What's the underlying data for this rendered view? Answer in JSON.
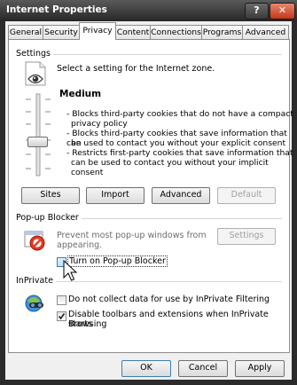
{
  "window": {
    "title": "Internet Properties",
    "help_label": "?",
    "close_label": "✕"
  },
  "tabs": [
    {
      "label": "General"
    },
    {
      "label": "Security"
    },
    {
      "label": "Privacy"
    },
    {
      "label": "Content"
    },
    {
      "label": "Connections"
    },
    {
      "label": "Programs"
    },
    {
      "label": "Advanced"
    }
  ],
  "settings": {
    "group_label": "Settings",
    "instruction": "Select a setting for the Internet zone.",
    "level": "Medium",
    "description": [
      "- Blocks third-party cookies that do not have a compact",
      "privacy policy",
      "- Blocks third-party cookies that save information that can",
      "be used to contact you without your explicit consent",
      "- Restricts first-party cookies that save information that",
      "can be used to contact you without your implicit consent"
    ],
    "buttons": {
      "sites": "Sites",
      "import": "Import",
      "advanced": "Advanced",
      "default": "Default"
    }
  },
  "popup": {
    "group_label": "Pop-up Blocker",
    "description": [
      "Prevent most pop-up windows from",
      "appearing."
    ],
    "settings_button": "Settings",
    "turn_on_label": "Turn on Pop-up Blocker",
    "turn_on_checked": false
  },
  "inprivate": {
    "group_label": "InPrivate",
    "option1_label": "Do not collect data for use by InPrivate Filtering",
    "option1_checked": false,
    "option2_lines": [
      "Disable toolbars and extensions when InPrivate Browsing",
      "starts"
    ],
    "option2_checked": true
  },
  "footer": {
    "ok": "OK",
    "cancel": "Cancel",
    "apply": "Apply"
  },
  "colors": {
    "title_bar": "#2b2b2b",
    "close_button": "#c4371a",
    "dialog_bg": "#f0f0f0",
    "panel_bg": "#ffffff"
  }
}
